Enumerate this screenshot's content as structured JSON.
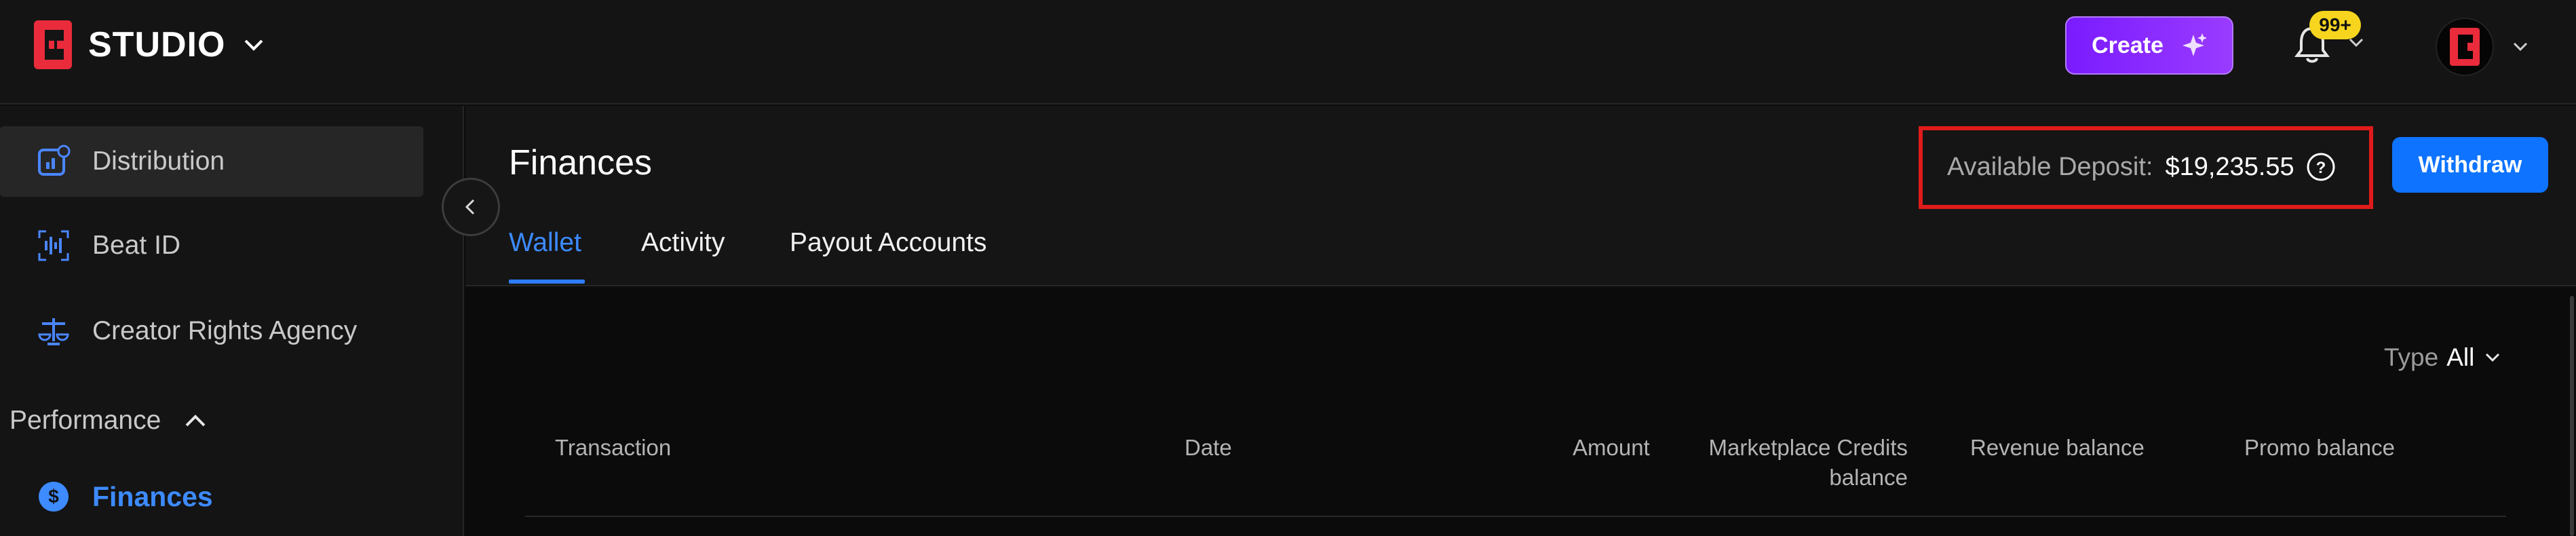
{
  "app": {
    "brand_name": "STUDIO",
    "create_label": "Create",
    "notifications_badge": "99+"
  },
  "sidebar": {
    "items": [
      {
        "label": "Distribution",
        "icon": "distribution-icon",
        "active": true
      },
      {
        "label": "Beat ID",
        "icon": "waveform-icon",
        "active": false
      },
      {
        "label": "Creator Rights Agency",
        "icon": "scales-icon",
        "active": false
      }
    ],
    "section_label": "Performance",
    "finances_label": "Finances"
  },
  "page": {
    "title": "Finances",
    "deposit_label": "Available Deposit:",
    "deposit_value": "$19,235.55",
    "withdraw_label": "Withdraw",
    "tabs": [
      "Wallet",
      "Activity",
      "Payout Accounts"
    ],
    "active_tab": "Wallet"
  },
  "filter": {
    "type_label": "Type",
    "type_value": "All"
  },
  "table": {
    "columns": [
      "Transaction",
      "Date",
      "Amount",
      "Marketplace Credits balance",
      "Revenue balance",
      "Promo balance"
    ]
  },
  "colors": {
    "accent_blue": "#0e73ff",
    "create_purple": "#8a2bff",
    "highlight_red": "#e01b1b",
    "badge_yellow": "#f7d51f"
  }
}
